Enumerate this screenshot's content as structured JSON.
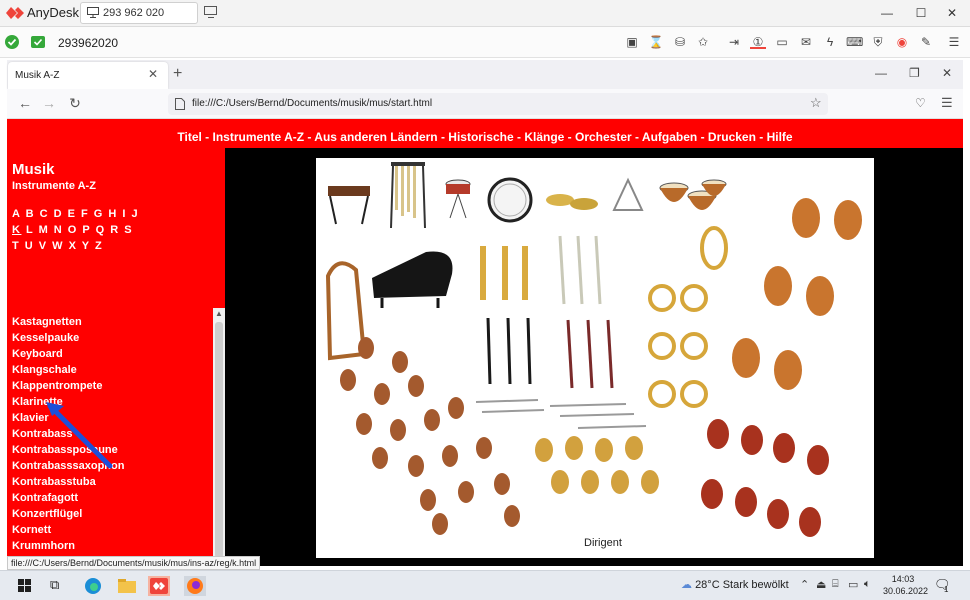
{
  "anydesk": {
    "app_name": "AnyDesk",
    "tab_address": "293 962 020",
    "connected_id": "293962020",
    "window_controls": {
      "minimize": "—",
      "maximize": "☐",
      "close": "✕"
    }
  },
  "browser": {
    "tab_title": "Musik A-Z",
    "tab_close": "✕",
    "new_tab": "+",
    "url": "file:///C:/Users/Bernd/Documents/musik/mus/start.html",
    "nav": {
      "back": "←",
      "forward": "→",
      "reload": "↻"
    },
    "window_controls": {
      "minimize": "—",
      "restore": "❐",
      "close": "✕"
    }
  },
  "page": {
    "topnav": "Titel - Instrumente A-Z - Aus anderen Ländern - Historische - Klänge - Orchester - Aufgaben - Drucken - Hilfe",
    "sidebar": {
      "title": "Musik",
      "subtitle": "Instrumente A-Z",
      "alphabet_rows": [
        "A B C D E F G H I J",
        "K L M N O P Q R S",
        "T U V W X Y Z"
      ],
      "active_letter": "K",
      "items": [
        "Kastagnetten",
        "Kesselpauke",
        "Keyboard",
        "Klangschale",
        "Klappentrompete",
        "Klarinette",
        "Klavier",
        "Kontrabass",
        "Kontrabassposaune",
        "Kontrabasssaxophon",
        "Kontrabasstuba",
        "Kontrafagott",
        "Konzertflügel",
        "Kornett",
        "Krummhorn"
      ]
    },
    "illustration_caption": "Dirigent"
  },
  "status_url": "file:///C:/Users/Bernd/Documents/musik/mus/ins-az/reg/k.html",
  "taskbar": {
    "weather": "28°C  Stark bewölkt",
    "time": "14:03",
    "date": "30.06.2022",
    "notification_count": "1"
  },
  "colors": {
    "page_red": "#ff0000",
    "anydesk_red": "#ef443b",
    "page_black": "#000000"
  }
}
